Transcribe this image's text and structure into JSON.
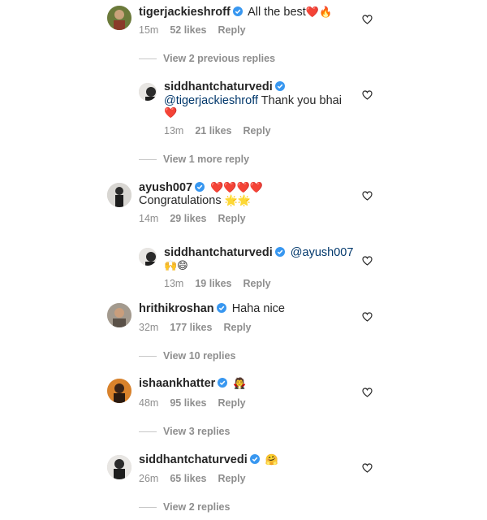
{
  "comments": [
    {
      "username": "tigerjackieshroff",
      "text": "All the best",
      "emoji": "❤️🔥",
      "time": "15m",
      "likes": "52 likes",
      "reply": "Reply"
    },
    {
      "username": "siddhantchaturvedi",
      "mention": "@tigerjackieshroff",
      "text": "Thank you bhai",
      "emoji": "❤️",
      "time": "13m",
      "likes": "21 likes",
      "reply": "Reply"
    },
    {
      "username": "ayush007",
      "emoji_inline": "❤️❤️❤️❤️",
      "text": "Congratulations",
      "emoji": "🌟🌟",
      "time": "14m",
      "likes": "29 likes",
      "reply": "Reply"
    },
    {
      "username": "siddhantchaturvedi",
      "mention": "@ayush007",
      "emoji": "🙌😄",
      "time": "13m",
      "likes": "19 likes",
      "reply": "Reply"
    },
    {
      "username": "hrithikroshan",
      "text": "Haha nice",
      "time": "32m",
      "likes": "177 likes",
      "reply": "Reply"
    },
    {
      "username": "ishaankhatter",
      "emoji": "🧛",
      "time": "48m",
      "likes": "95 likes",
      "reply": "Reply"
    },
    {
      "username": "siddhantchaturvedi",
      "emoji": "🤗",
      "time": "26m",
      "likes": "65 likes",
      "reply": "Reply"
    }
  ],
  "view_replies": [
    "View 2 previous replies",
    "View 1 more reply",
    "View 10 replies",
    "View 3 replies",
    "View 2 replies"
  ],
  "colors": {
    "verified": "#3897f0",
    "meta": "#8e8e8e",
    "heart_outline": "#262626"
  },
  "icons": {
    "verified": "verified-badge-icon",
    "like": "heart-outline-icon"
  }
}
